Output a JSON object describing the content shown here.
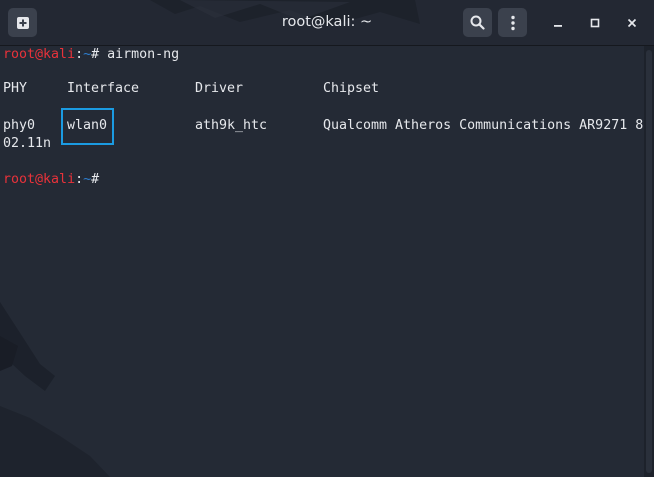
{
  "window": {
    "title": "root@kali: ~"
  },
  "titlebar": {
    "new_tab_icon": "new-tab-icon",
    "search_icon": "search-icon",
    "menu_icon": "kebab-menu-icon",
    "minimize_icon": "minimize-icon",
    "maximize_icon": "maximize-icon",
    "close_icon": "close-icon"
  },
  "terminal": {
    "prompt_user": "root",
    "prompt_at": "@",
    "prompt_host": "kali",
    "prompt_colon": ":",
    "prompt_dir": "~",
    "prompt_symbol": "# ",
    "command": "airmon-ng",
    "table": {
      "headers": [
        "PHY",
        "Interface",
        "Driver",
        "Chipset"
      ],
      "row": {
        "phy": "phy0",
        "interface": "wlan0",
        "driver": "ath9k_htc",
        "chipset_line1": "Qualcomm Atheros Communications AR9271 8",
        "chipset_line2": "02.11n"
      }
    }
  },
  "colors": {
    "prompt_red": "#e8323a",
    "prompt_blue": "#2e7fd0",
    "highlight_border": "#1b9be2",
    "background": "#242a35"
  }
}
